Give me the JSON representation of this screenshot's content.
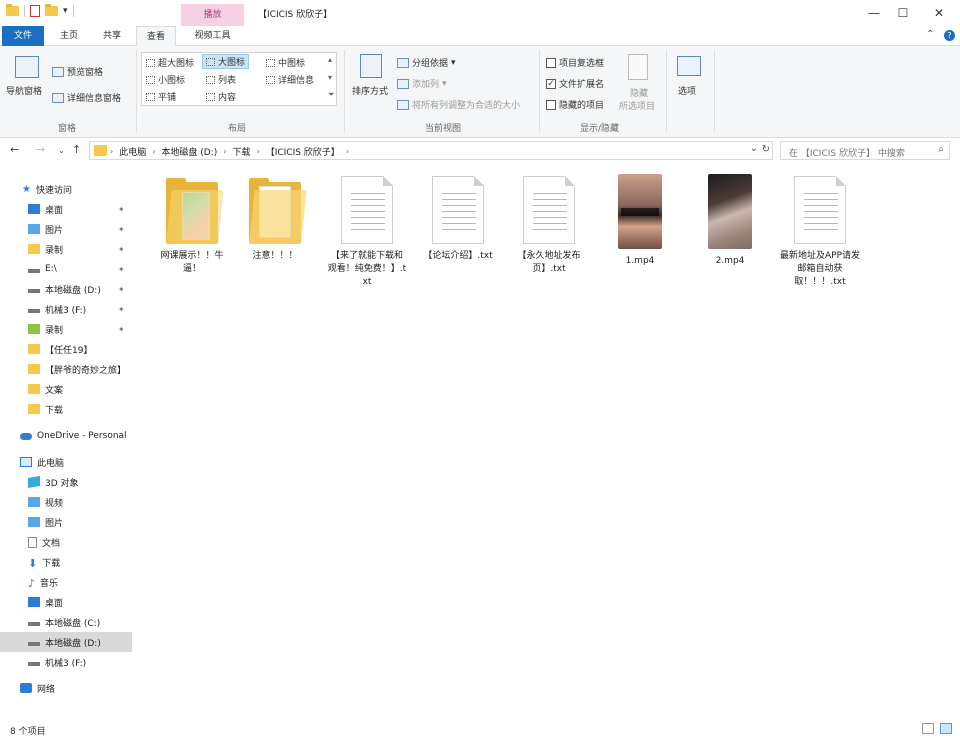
{
  "window": {
    "title": "【ICICIS 欣欣子】",
    "context_tab": "播放",
    "minimize": "—",
    "maximize": "☐",
    "close": "✕"
  },
  "tabs": {
    "file": "文件",
    "home": "主页",
    "share": "共享",
    "view": "查看",
    "video_tools": "视频工具",
    "collapse": "⌃"
  },
  "ribbon": {
    "panes": {
      "nav_pane": "导航窗格",
      "preview_pane": "预览窗格",
      "details_pane": "详细信息窗格",
      "label": "窗格"
    },
    "layout": {
      "extra_large": "超大图标",
      "large": "大图标",
      "medium": "中图标",
      "small": "小图标",
      "list": "列表",
      "details": "详细信息",
      "tiles": "平铺",
      "content": "内容",
      "label": "布局"
    },
    "current_view": {
      "sort": "排序方式",
      "group": "分组依据",
      "add_columns": "添加列",
      "fit_columns": "将所有列调整为合适的大小",
      "label": "当前视图"
    },
    "show_hide": {
      "item_checkboxes": "项目复选框",
      "file_extensions": "文件扩展名",
      "hidden_items": "隐藏的项目",
      "hide_selected": "隐藏",
      "hide_selected2": "所选项目",
      "label": "显示/隐藏",
      "item_checkboxes_checked": false,
      "file_extensions_checked": true,
      "hidden_items_checked": false
    },
    "options": "选项"
  },
  "address": {
    "crumbs": [
      "此电脑",
      "本地磁盘 (D:)",
      "下载",
      "【ICICIS 欣欣子】"
    ],
    "search_placeholder": "在 【ICICIS 欣欣子】 中搜索"
  },
  "nav": {
    "quick_access": "快速访问",
    "items": [
      {
        "label": "桌面",
        "icon": "desktop-icon",
        "pinned": true
      },
      {
        "label": "图片",
        "icon": "pictures-icon",
        "pinned": true
      },
      {
        "label": "录制",
        "icon": "folder-icon",
        "pinned": true
      },
      {
        "label": "E:\\",
        "icon": "drive-icon",
        "pinned": true
      },
      {
        "label": "本地磁盘 (D:)",
        "icon": "drive-icon",
        "pinned": true
      },
      {
        "label": "机械3 (F:)",
        "icon": "drive-icon",
        "pinned": true
      },
      {
        "label": "录制",
        "icon": "recording-icon",
        "pinned": true
      },
      {
        "label": "【任任19】",
        "icon": "folder-icon",
        "pinned": false
      },
      {
        "label": "【胖爷的奇妙之旅】",
        "icon": "folder-icon",
        "pinned": false
      },
      {
        "label": "文案",
        "icon": "folder-icon",
        "pinned": false
      },
      {
        "label": "下载",
        "icon": "folder-icon",
        "pinned": false
      }
    ],
    "onedrive": "OneDrive - Personal",
    "this_pc": "此电脑",
    "pc_items": [
      {
        "label": "3D 对象",
        "icon": "3d-objects-icon"
      },
      {
        "label": "视频",
        "icon": "videos-icon"
      },
      {
        "label": "图片",
        "icon": "pictures-icon"
      },
      {
        "label": "文档",
        "icon": "documents-icon"
      },
      {
        "label": "下载",
        "icon": "downloads-icon"
      },
      {
        "label": "音乐",
        "icon": "music-icon"
      },
      {
        "label": "桌面",
        "icon": "desktop-icon"
      },
      {
        "label": "本地磁盘 (C:)",
        "icon": "drive-icon"
      },
      {
        "label": "本地磁盘 (D:)",
        "icon": "drive-icon",
        "selected": true
      },
      {
        "label": "机械3 (F:)",
        "icon": "drive-icon"
      }
    ],
    "network": "网络"
  },
  "files": [
    {
      "name": "网课展示！！牛逼！",
      "type": "folder-colorful"
    },
    {
      "name": "注意！！！",
      "type": "folder"
    },
    {
      "name": "【来了就能下载和观看！纯免费！】.txt",
      "type": "txt"
    },
    {
      "name": "【论坛介绍】.txt",
      "type": "txt"
    },
    {
      "name": "【永久地址发布页】.txt",
      "type": "txt"
    },
    {
      "name": "1.mp4",
      "type": "video1"
    },
    {
      "name": "2.mp4",
      "type": "video2"
    },
    {
      "name": "最新地址及APP请发邮箱自动获取！！！.txt",
      "type": "txt"
    }
  ],
  "status": {
    "count": "8 个项目"
  }
}
